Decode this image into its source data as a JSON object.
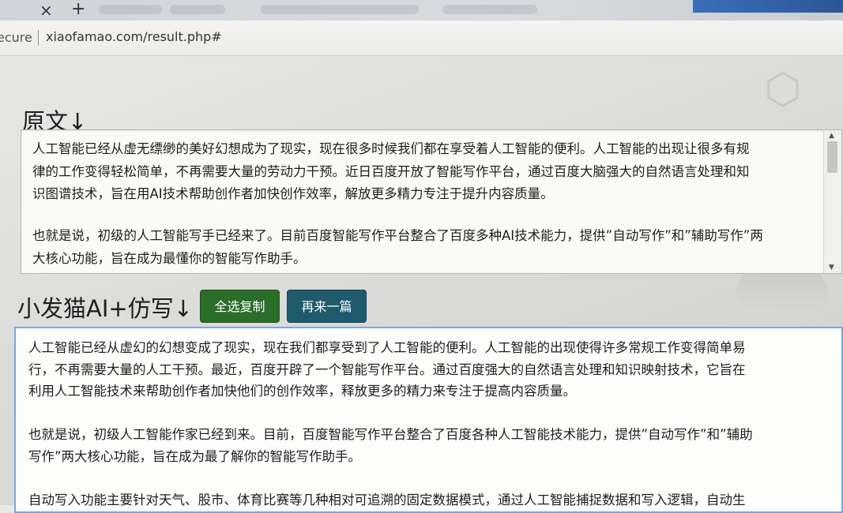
{
  "browser": {
    "close_tab_glyph": "×",
    "new_tab_glyph": "+",
    "security_label": "ecure",
    "url": "xiaofamao.com/result.php#"
  },
  "original": {
    "heading": "原文↓",
    "lines": [
      "人工智能已经从虚无缥缈的美好幻想成为了现实，现在很多时候我们都在享受着人工智能的便利。人工智能的出现让很多有规",
      "律的工作变得轻松简单，不再需要大量的劳动力干预。近日百度开放了智能写作平台，通过百度大脑强大的自然语言处理和知",
      "识图谱技术，旨在用AI技术帮助创作者加快创作效率，解放更多精力专注于提升内容质量。",
      "",
      "也就是说，初级的人工智能写手已经来了。目前百度智能写作平台整合了百度多种AI技术能力，提供”自动写作”和”辅助写作”两",
      "大核心功能，旨在成为最懂你的智能写作助手。"
    ]
  },
  "rewrite": {
    "heading": "小发猫AI+仿写↓",
    "copy_button": "全选复制",
    "again_button": "再来一篇",
    "lines": [
      "人工智能已经从虚幻的幻想变成了现实，现在我们都享受到了人工智能的便利。人工智能的出现使得许多常规工作变得简单易",
      "行，不再需要大量的人工干预。最近，百度开辟了一个智能写作平台。通过百度强大的自然语言处理和知识映射技术，它旨在",
      "利用人工智能技术来帮助创作者加快他们的创作效率，释放更多的精力来专注于提高内容质量。",
      "",
      "也就是说，初级人工智能作家已经到来。目前，百度智能写作平台整合了百度各种人工智能技术能力，提供”自动写作”和”辅助",
      "写作”两大核心功能，旨在成为最了解你的智能写作助手。",
      "",
      "自动写入功能主要针对天气、股市、体育比赛等几种相对可追溯的固定数据模式，通过人工智能捕捉数据和写入逻辑，自动生"
    ]
  },
  "colors": {
    "copy_button": "#2a6e2a",
    "again_button": "#1f5a6d",
    "focus_border": "#7da6d8"
  }
}
